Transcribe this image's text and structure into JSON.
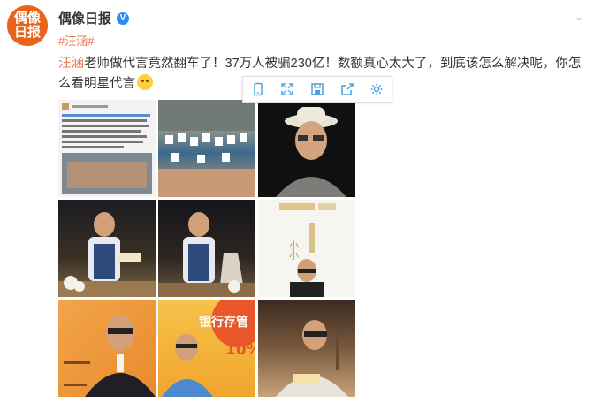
{
  "account": {
    "avatar_text": [
      "偶像",
      "日报"
    ],
    "name": "偶像日报",
    "verified_mark": "V",
    "colors": {
      "avatar_bg": "#e8641b",
      "link": "#eb7350",
      "icon_blue": "#4aa3e0"
    }
  },
  "post": {
    "hashtag": "#汪涵#",
    "mention": "汪涵",
    "body": "老师做代言竟然翻车了！37万人被骗230亿！数额真心太大了，到底该怎么解决呢，你怎么看明星代言",
    "emoji": "thinking-face-emoji"
  },
  "image_toolbar": {
    "buttons": [
      "mobile-view-icon",
      "expand-icon",
      "save-icon",
      "share-icon",
      "settings-icon"
    ]
  },
  "photos": {
    "p8_label_top": "银行存管",
    "p8_label_pct": "10%",
    "p6_label": "小小"
  }
}
